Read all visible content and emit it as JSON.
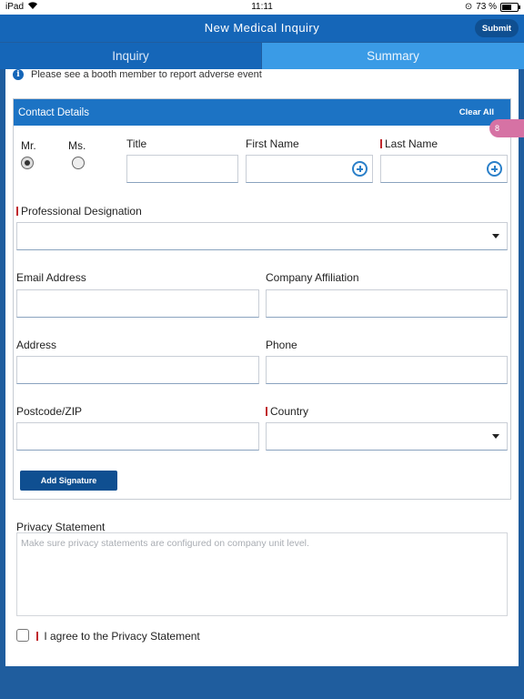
{
  "status_bar": {
    "device": "iPad",
    "time": "11:11",
    "battery_percent": "73 %",
    "battery_level": 0.73
  },
  "nav": {
    "title": "New Medical Inquiry",
    "submit_label": "Submit"
  },
  "tabs": [
    {
      "label": "Inquiry"
    },
    {
      "label": "Summary"
    }
  ],
  "notice": {
    "text": "Please see a booth member to report adverse event"
  },
  "contact": {
    "header": "Contact Details",
    "clear_all": "Clear All",
    "badge": "8",
    "salutations": [
      {
        "label": "Mr.",
        "selected": true
      },
      {
        "label": "Ms.",
        "selected": false
      }
    ],
    "labels": {
      "title": "Title",
      "first_name": "First Name",
      "last_name": "Last Name",
      "professional_designation": "Professional Designation",
      "email": "Email Address",
      "company": "Company Affiliation",
      "address": "Address",
      "phone": "Phone",
      "postcode": "Postcode/ZIP",
      "country": "Country"
    },
    "add_signature": "Add Signature"
  },
  "privacy": {
    "label": "Privacy Statement",
    "placeholder": "Make sure privacy statements are configured on company unit level.",
    "agree": "I agree to the Privacy Statement"
  },
  "colors": {
    "nav": "#1566b8",
    "accent": "#1c73c4",
    "badge": "#d672a4",
    "required": "#c0282d"
  }
}
